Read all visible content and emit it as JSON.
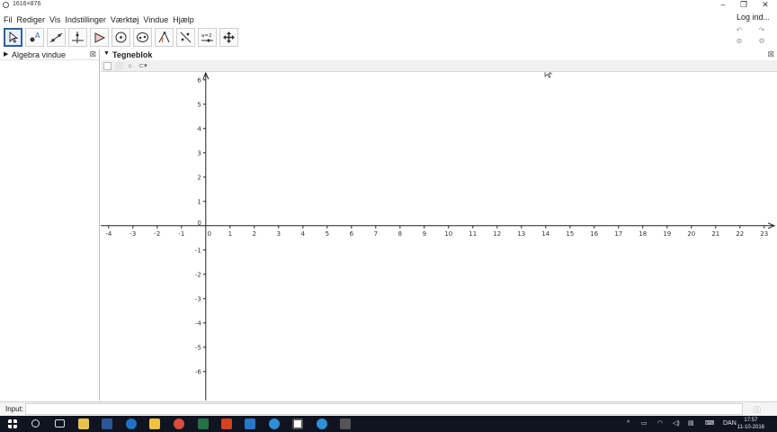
{
  "window": {
    "title": "1616×876",
    "minimize": "–",
    "restore": "❐",
    "close": "✕"
  },
  "menu": {
    "items": [
      "Fil",
      "Rediger",
      "Vis",
      "Indstillinger",
      "Værktøj",
      "Vindue",
      "Hjælp"
    ],
    "login": "Log ind..."
  },
  "toolbar": {
    "tools": [
      "move-tool",
      "point-tool",
      "line-tool",
      "perpendicular-line-tool",
      "polygon-tool",
      "circle-tool",
      "ellipse-tool",
      "angle-tool",
      "reflect-tool",
      "slider-tool",
      "move-graphics-view-tool"
    ],
    "slider_label": "a=2"
  },
  "algebra_panel": {
    "title": "Algebra vindue"
  },
  "graphics_panel": {
    "title": "Tegneblok",
    "axes": {
      "x_ticks": [
        -4,
        -3,
        -2,
        -1,
        0,
        1,
        2,
        3,
        4,
        5,
        6,
        7,
        8,
        9,
        10,
        11,
        12,
        13,
        14,
        15,
        16,
        17,
        18,
        19,
        20,
        21,
        22,
        23
      ],
      "y_ticks": [
        6,
        5,
        4,
        3,
        2,
        1,
        0,
        -1,
        -2,
        -3,
        -4,
        -5,
        -6
      ],
      "xlim": [
        -4.3,
        23.3
      ],
      "ylim": [
        -7.3,
        6.2
      ]
    }
  },
  "input_bar": {
    "label": "Input:"
  },
  "taskbar": {
    "language": "DAN",
    "time": "17:57",
    "date": "11-10-2016"
  },
  "colors": {
    "taskbar": "#101420",
    "active_tool": "#2f5f9e",
    "axis": "#222222"
  }
}
